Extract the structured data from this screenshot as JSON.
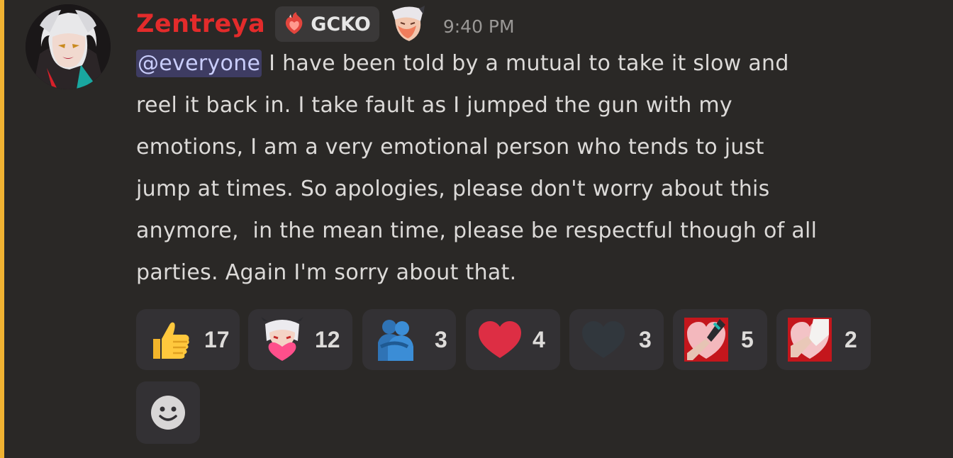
{
  "message": {
    "author": "Zentreya",
    "author_color": "#e32b2b",
    "server_tag": {
      "label": "GCKO",
      "icon": "flame-heart-icon"
    },
    "sticker": "character-sticker-icon",
    "timestamp": "9:40 PM",
    "mention": "@everyone",
    "lines": [
      " I have been told by a mutual to take it slow and",
      "reel it back in. I take fault as I jumped the gun with my",
      "emotions, I am a very emotional person who tends to just",
      "jump at times. So apologies, please don't worry about this",
      "anymore,  in the mean time, please be respectful though of all",
      "parties. Again I'm sorry about that."
    ],
    "mention_highlight_color": "#f0b232"
  },
  "reactions": [
    {
      "emoji": "thumbs-up-icon",
      "count": "17"
    },
    {
      "emoji": "character-heart-icon",
      "count": "12"
    },
    {
      "emoji": "hugging-people-icon",
      "count": "3"
    },
    {
      "emoji": "red-heart-icon",
      "count": "4"
    },
    {
      "emoji": "black-heart-icon",
      "count": "3"
    },
    {
      "emoji": "holding-hands-heart-icon",
      "count": "5"
    },
    {
      "emoji": "holding-hands-heart-2-icon",
      "count": "2"
    }
  ],
  "add_reaction": {
    "icon": "smiley-add-icon"
  }
}
